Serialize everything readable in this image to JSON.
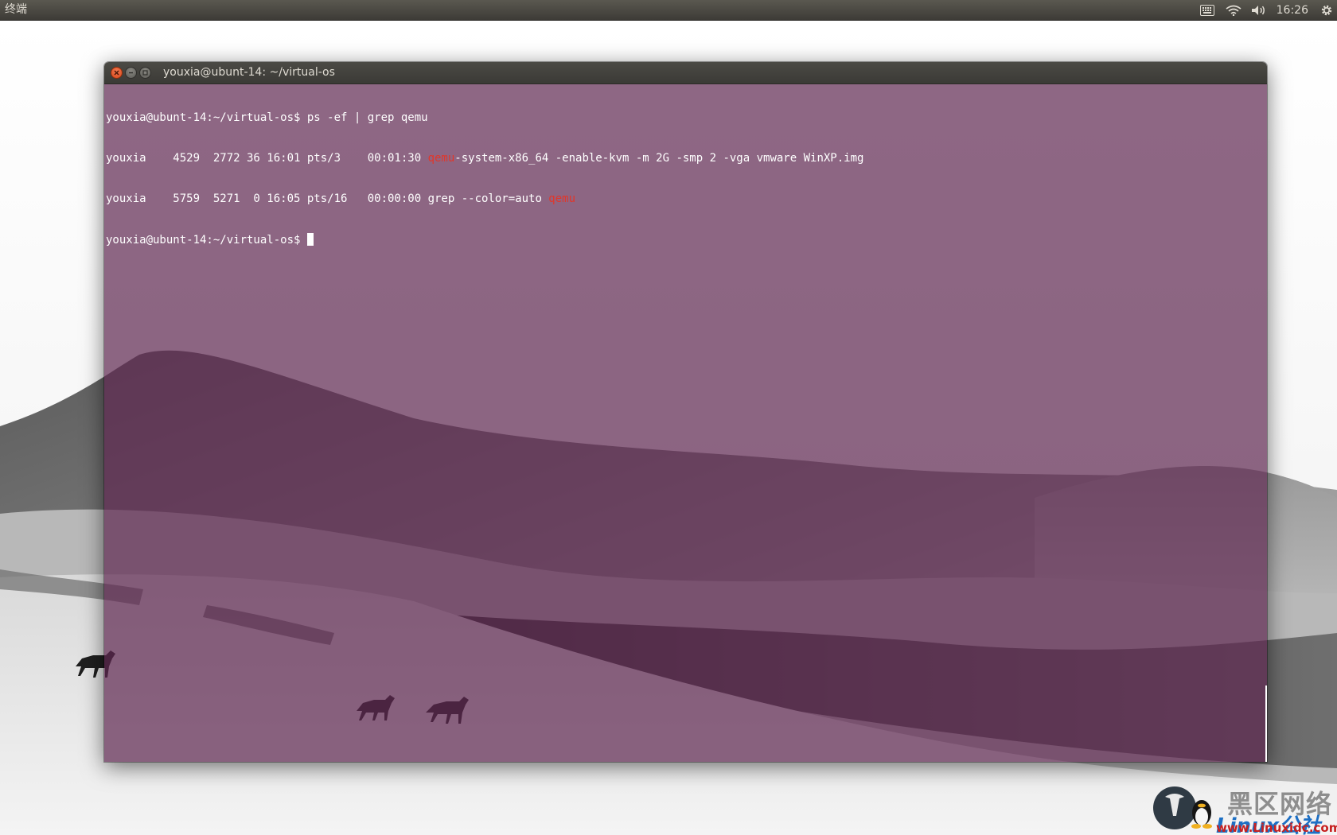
{
  "panel": {
    "app_title": "终端",
    "clock": "16:26",
    "icons": [
      "keyboard-icon",
      "wifi-icon",
      "volume-icon",
      "gear-icon"
    ]
  },
  "window": {
    "title": "youxia@ubunt-14: ~/virtual-os",
    "buttons": [
      "close-icon",
      "minimize-icon",
      "maximize-icon"
    ]
  },
  "terminal": {
    "colors": {
      "background": "#5e2750",
      "text": "#ffffff",
      "match": "#e2362a"
    },
    "lines": [
      {
        "segments": [
          {
            "text": "youxia@ubunt-14:~/virtual-os$ ps -ef | grep qemu"
          }
        ]
      },
      {
        "segments": [
          {
            "text": "youxia    4529  2772 36 16:01 pts/3    00:01:30 "
          },
          {
            "text": "qemu",
            "highlight": true
          },
          {
            "text": "-system-x86_64 -enable-kvm -m 2G -smp 2 -vga vmware WinXP.img"
          }
        ]
      },
      {
        "segments": [
          {
            "text": "youxia    5759  5271  0 16:05 pts/16   00:00:00 grep --color=auto "
          },
          {
            "text": "qemu",
            "highlight": true
          }
        ]
      },
      {
        "segments": [
          {
            "text": "youxia@ubunt-14:~/virtual-os$ "
          }
        ],
        "cursor": true
      }
    ]
  },
  "watermark": {
    "chinese": "黑区网络",
    "brand": "Linux公社",
    "url": "www.Linuxidc.com"
  }
}
